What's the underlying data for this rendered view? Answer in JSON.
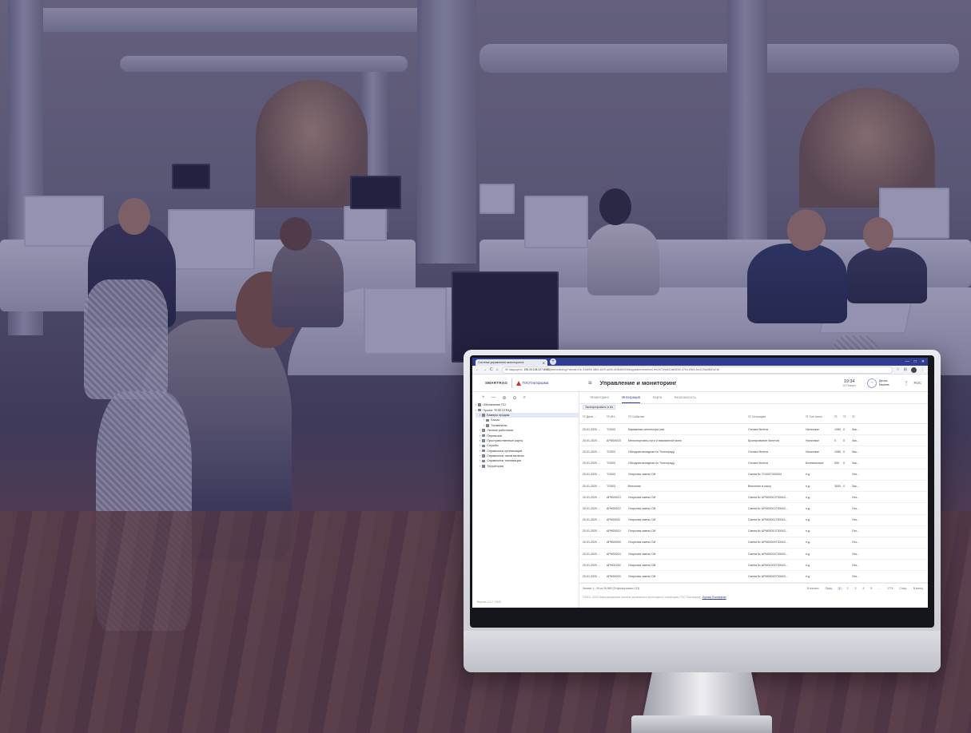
{
  "browser": {
    "tab_title": "Система управления мониторинга",
    "new_tab_icon": "+",
    "window_controls": [
      "—",
      "□",
      "✕"
    ],
    "nav_icons": [
      "←",
      "→",
      "C",
      "⌂"
    ],
    "security_label": "Не защищено",
    "url_host": "195.34.108.227:8085",
    "url_path": "/ptomonitoring/?viewId=f1e-93db9b-38b5-4629-ad0b-b1f4b8ef30bf/signatureview/form-reh2072/ybb10ab5040-47e4-49e8-9cc0-2fa2d8d1a7a0",
    "ext_icons": [
      "☆",
      "⊞",
      "⋮"
    ]
  },
  "app": {
    "logo_primary": "SMARTRAG",
    "logo_secondary": "ТОСПлатформа",
    "menu_icon": "≡",
    "title": "Управление и мониторинг",
    "time": "19:34",
    "date": "25 Января",
    "user_name_line1": "Денис",
    "user_name_line2": "Евсеев",
    "more_icon": "⋮",
    "lang": "RUC"
  },
  "sidebar": {
    "tools": [
      "+",
      "—",
      "⊕",
      "⊖",
      "⌕"
    ],
    "items": [
      {
        "label": "Обновление ПО",
        "indent": 0,
        "selected": false
      },
      {
        "label": "Проект ТЕЛЕОГРАД",
        "indent": 0,
        "selected": false
      },
      {
        "label": "Камеры продаж",
        "indent": 1,
        "selected": true
      },
      {
        "label": "Кассы",
        "indent": 2,
        "selected": false
      },
      {
        "label": "Терминалы",
        "indent": 2,
        "selected": false
      },
      {
        "label": "Личные работники",
        "indent": 1,
        "selected": false
      },
      {
        "label": "Перевозки",
        "indent": 1,
        "selected": false
      },
      {
        "label": "Пространственные карты",
        "indent": 1,
        "selected": false
      },
      {
        "label": "Службы",
        "indent": 1,
        "selected": false
      },
      {
        "label": "Справочник организаций",
        "indent": 1,
        "selected": false
      },
      {
        "label": "Справочник типов валюты",
        "indent": 1,
        "selected": false
      },
      {
        "label": "Справочник топливации",
        "indent": 1,
        "selected": false
      },
      {
        "label": "Территория",
        "indent": 1,
        "selected": false
      }
    ],
    "version": "Версия 1.0.2 / 2020"
  },
  "tabs": [
    "Мониторинг",
    "Интеграция",
    "Карта",
    "Безопасность"
  ],
  "export_label": "Экспортировать в xls",
  "table": {
    "headers": [
      "Дата ...",
      "ИН...",
      "Событие",
      "Операция",
      "Тип опла...",
      "",
      "",
      ""
    ],
    "rows": [
      [
        "20.01.2020 ...",
        "TG003",
        "Карманная кинотеатра уже",
        "Оплата билета",
        "Наличные",
        "1080",
        "0",
        "Зак..."
      ],
      [
        "20.01.2020 ...",
        "АРМ00015",
        "Мелкоторговец пути и пикованной мини",
        "Бронирование билетов",
        "Наличные",
        "0",
        "0",
        "Зак..."
      ],
      [
        "20.01.2020 ...",
        "TG003",
        "Обходная вкладная по Телеограду",
        "Оплата билета",
        "Наличные",
        "1080",
        "0",
        "Зак..."
      ],
      [
        "20.01.2020 ...",
        "TG003",
        "Обходная вкладная по Телеограду",
        "Оплата билета",
        "Безналичные",
        "500",
        "0",
        "Зак..."
      ],
      [
        "20.01.2020 ...",
        "TG003",
        "Открытая смены ОИ",
        "Смена № TG0007300004",
        "н.д.",
        "",
        "",
        "Отк..."
      ],
      [
        "20.01.2020 ...",
        "TG003",
        "Внесение",
        "Внесение в кассу",
        "н.д.",
        "3000",
        "0",
        "Зак..."
      ],
      [
        "20.01.2020 ...",
        "АРМ00013",
        "Открытая смены ОИ",
        "Смена № АРМ00013730043...",
        "н.д.",
        "",
        "",
        "Отк..."
      ],
      [
        "20.01.2020 ...",
        "АРМ00012",
        "Открытая смены ОИ",
        "Смена № АРМ00012730043...",
        "н.д.",
        "",
        "",
        "Отк..."
      ],
      [
        "20.01.2020 ...",
        "АРМ00011",
        "Открытая смены ОИ",
        "Смена № АРМ00011730043...",
        "н.д.",
        "",
        "",
        "Отк..."
      ],
      [
        "20.01.2020 ...",
        "АРМ00010",
        "Открытая смены ОИ",
        "Смена № АРМ00010730043...",
        "н.д.",
        "",
        "",
        "Отк..."
      ],
      [
        "20.01.2020 ...",
        "АРМ00009",
        "Открытая смены ОИ",
        "Смена № АРМ00009730043...",
        "н.д.",
        "",
        "",
        "Отк..."
      ],
      [
        "20.01.2020 ...",
        "АРМ00024",
        "Открытая смены ОИ",
        "Смена № АРМ00024730043...",
        "н.д.",
        "",
        "",
        "Отк..."
      ],
      [
        "20.01.2020 ...",
        "АРМ01002",
        "Открытая смены ОИ",
        "Смена № АРМ01002730043...",
        "н.д.",
        "",
        "",
        "Отк..."
      ],
      [
        "20.01.2020 ...",
        "АРМ00020",
        "Открытая смены ОИ",
        "Смена № АРМ00020730043...",
        "н.д.",
        "",
        "",
        "Отк..."
      ]
    ]
  },
  "footer": {
    "records": "Записи 1 - 15 из 26 569 (Отфильтровано 113)",
    "pager": [
      "В начало",
      "Пред.",
      "1",
      "2",
      "3",
      "4",
      "5",
      "...",
      "1774",
      "След.",
      "В конец"
    ],
    "current_page": "1",
    "copyright": "©2019—2020 Информационная система управления и мониторинга, платформа «ТОС Платформа»",
    "link": "Оценка Платформы"
  }
}
